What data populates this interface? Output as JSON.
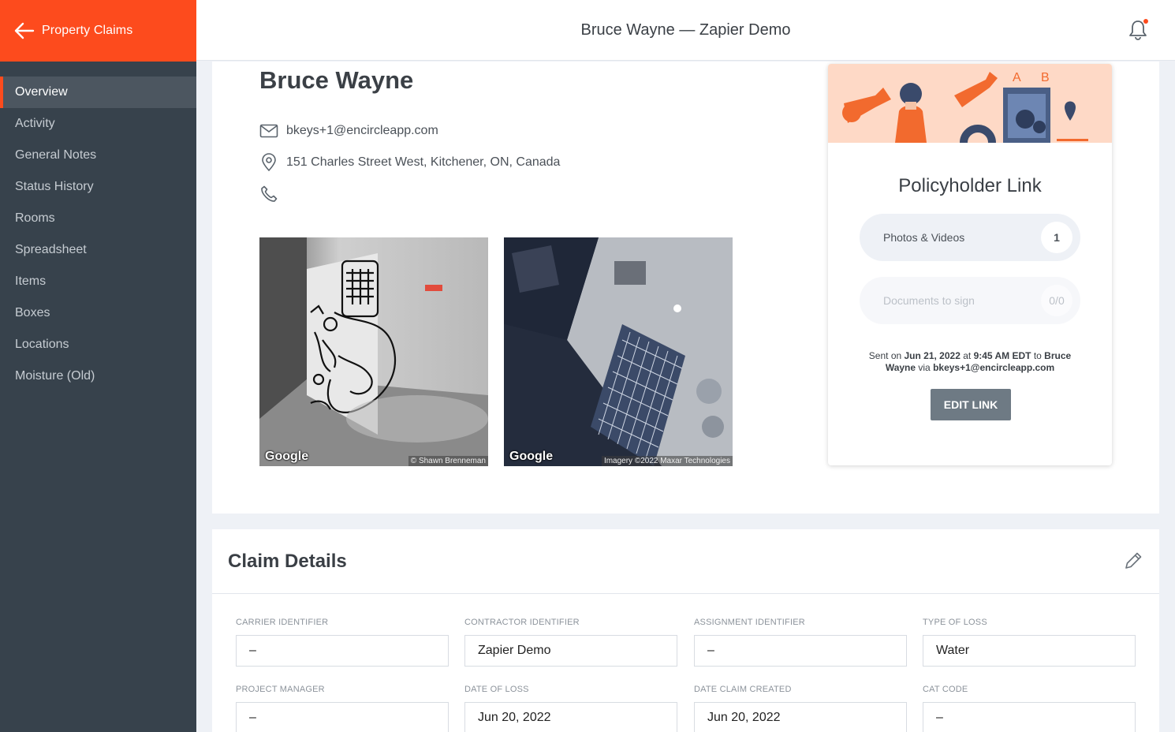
{
  "app": {
    "back_label": "Property Claims",
    "page_title": "Bruce Wayne — Zapier Demo"
  },
  "sidebar": {
    "items": [
      {
        "label": "Overview"
      },
      {
        "label": "Activity"
      },
      {
        "label": "General Notes"
      },
      {
        "label": "Status History"
      },
      {
        "label": "Rooms"
      },
      {
        "label": "Spreadsheet"
      },
      {
        "label": "Items"
      },
      {
        "label": "Boxes"
      },
      {
        "label": "Locations"
      },
      {
        "label": "Moisture (Old)"
      }
    ],
    "active_index": 0
  },
  "contact": {
    "name": "Bruce Wayne",
    "email": "bkeys+1@encircleapp.com",
    "address": "151 Charles Street West, Kitchener, ON, Canada",
    "phone": ""
  },
  "photos": {
    "street": {
      "logo": "Google",
      "credit": "© Shawn Brenneman"
    },
    "satellite": {
      "logo": "Google",
      "credit": "Imagery ©2022 Maxar Technologies"
    }
  },
  "policy_link": {
    "art_letters": [
      "A",
      "B"
    ],
    "title": "Policyholder Link",
    "photos_label": "Photos & Videos",
    "photos_count": "1",
    "docs_label": "Documents to sign",
    "docs_count": "0/0",
    "sent_prefix": "Sent on ",
    "sent_date": "Jun 21, 2022",
    "sent_at": " at ",
    "sent_time": "9:45 AM EDT",
    "sent_to": " to ",
    "sent_name": "Bruce Wayne",
    "sent_via": " via ",
    "sent_email": "bkeys+1@encircleapp.com",
    "edit_button": "EDIT LINK"
  },
  "claim_details": {
    "title": "Claim Details",
    "fields": [
      {
        "label": "CARRIER IDENTIFIER",
        "value": "–"
      },
      {
        "label": "CONTRACTOR IDENTIFIER",
        "value": "Zapier Demo"
      },
      {
        "label": "ASSIGNMENT IDENTIFIER",
        "value": "–"
      },
      {
        "label": "TYPE OF LOSS",
        "value": "Water"
      },
      {
        "label": "PROJECT MANAGER",
        "value": "–"
      },
      {
        "label": "DATE OF LOSS",
        "value": "Jun 20, 2022"
      },
      {
        "label": "DATE CLAIM CREATED",
        "value": "Jun 20, 2022"
      },
      {
        "label": "CAT CODE",
        "value": "–"
      }
    ]
  },
  "colors": {
    "accent": "#fd4b1d",
    "sidebar_bg": "#37424c",
    "button_bg": "#6e7a84"
  },
  "icons": {
    "back": "arrow-left-icon",
    "bell": "bell-icon",
    "email": "envelope-icon",
    "address": "map-pin-icon",
    "phone": "phone-icon",
    "edit": "pencil-icon"
  }
}
